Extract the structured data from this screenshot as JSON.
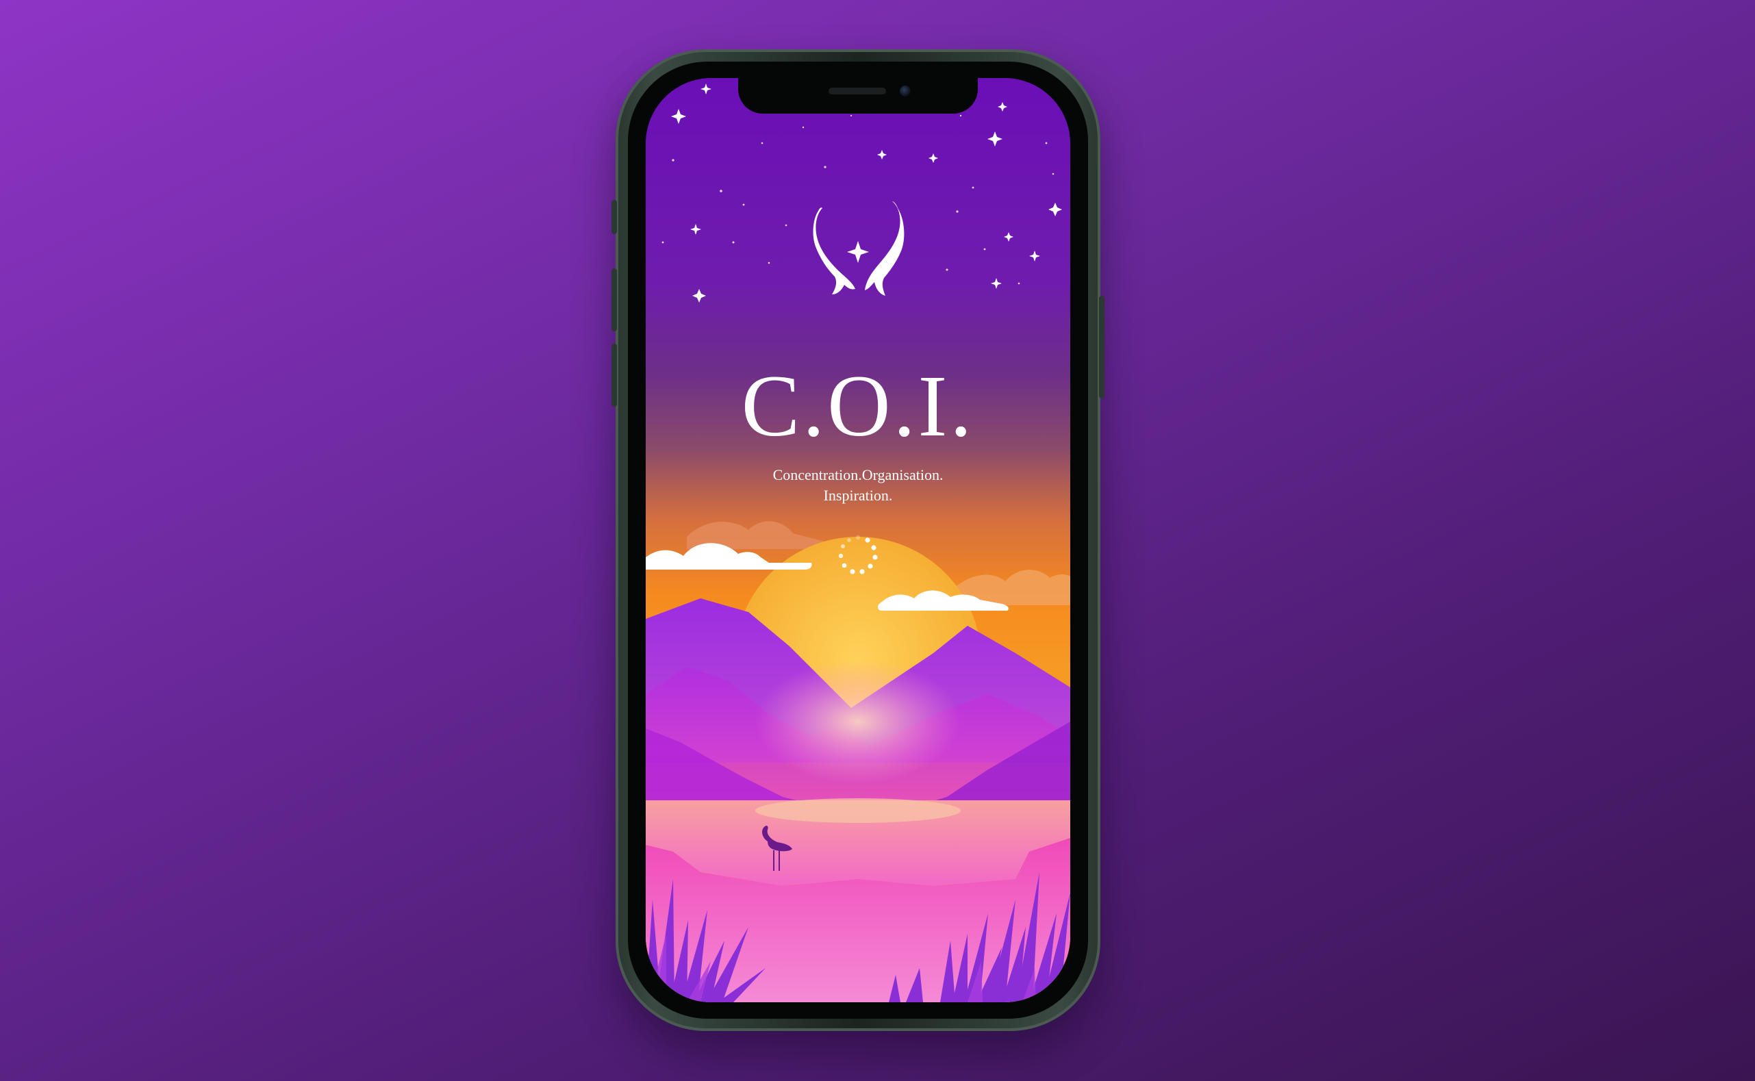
{
  "app": {
    "title": "C.O.I.",
    "tagline_line1": "Concentration.Organisation.",
    "tagline_line2": "Inspiration."
  },
  "screen": {
    "state": "splash-loading",
    "logo_icon": "twin-koi-fish-icon",
    "loading_icon": "loading-spinner-icon"
  },
  "colors": {
    "background_top": "#8e34c6",
    "background_bottom": "#3a1552",
    "sky_top": "#6d12b8",
    "sunset_orange": "#f08a2a",
    "sun": "#f7b43c",
    "mountain": "#8a2ad0",
    "lake_pink": "#f03ab0",
    "text": "#ffffff"
  }
}
